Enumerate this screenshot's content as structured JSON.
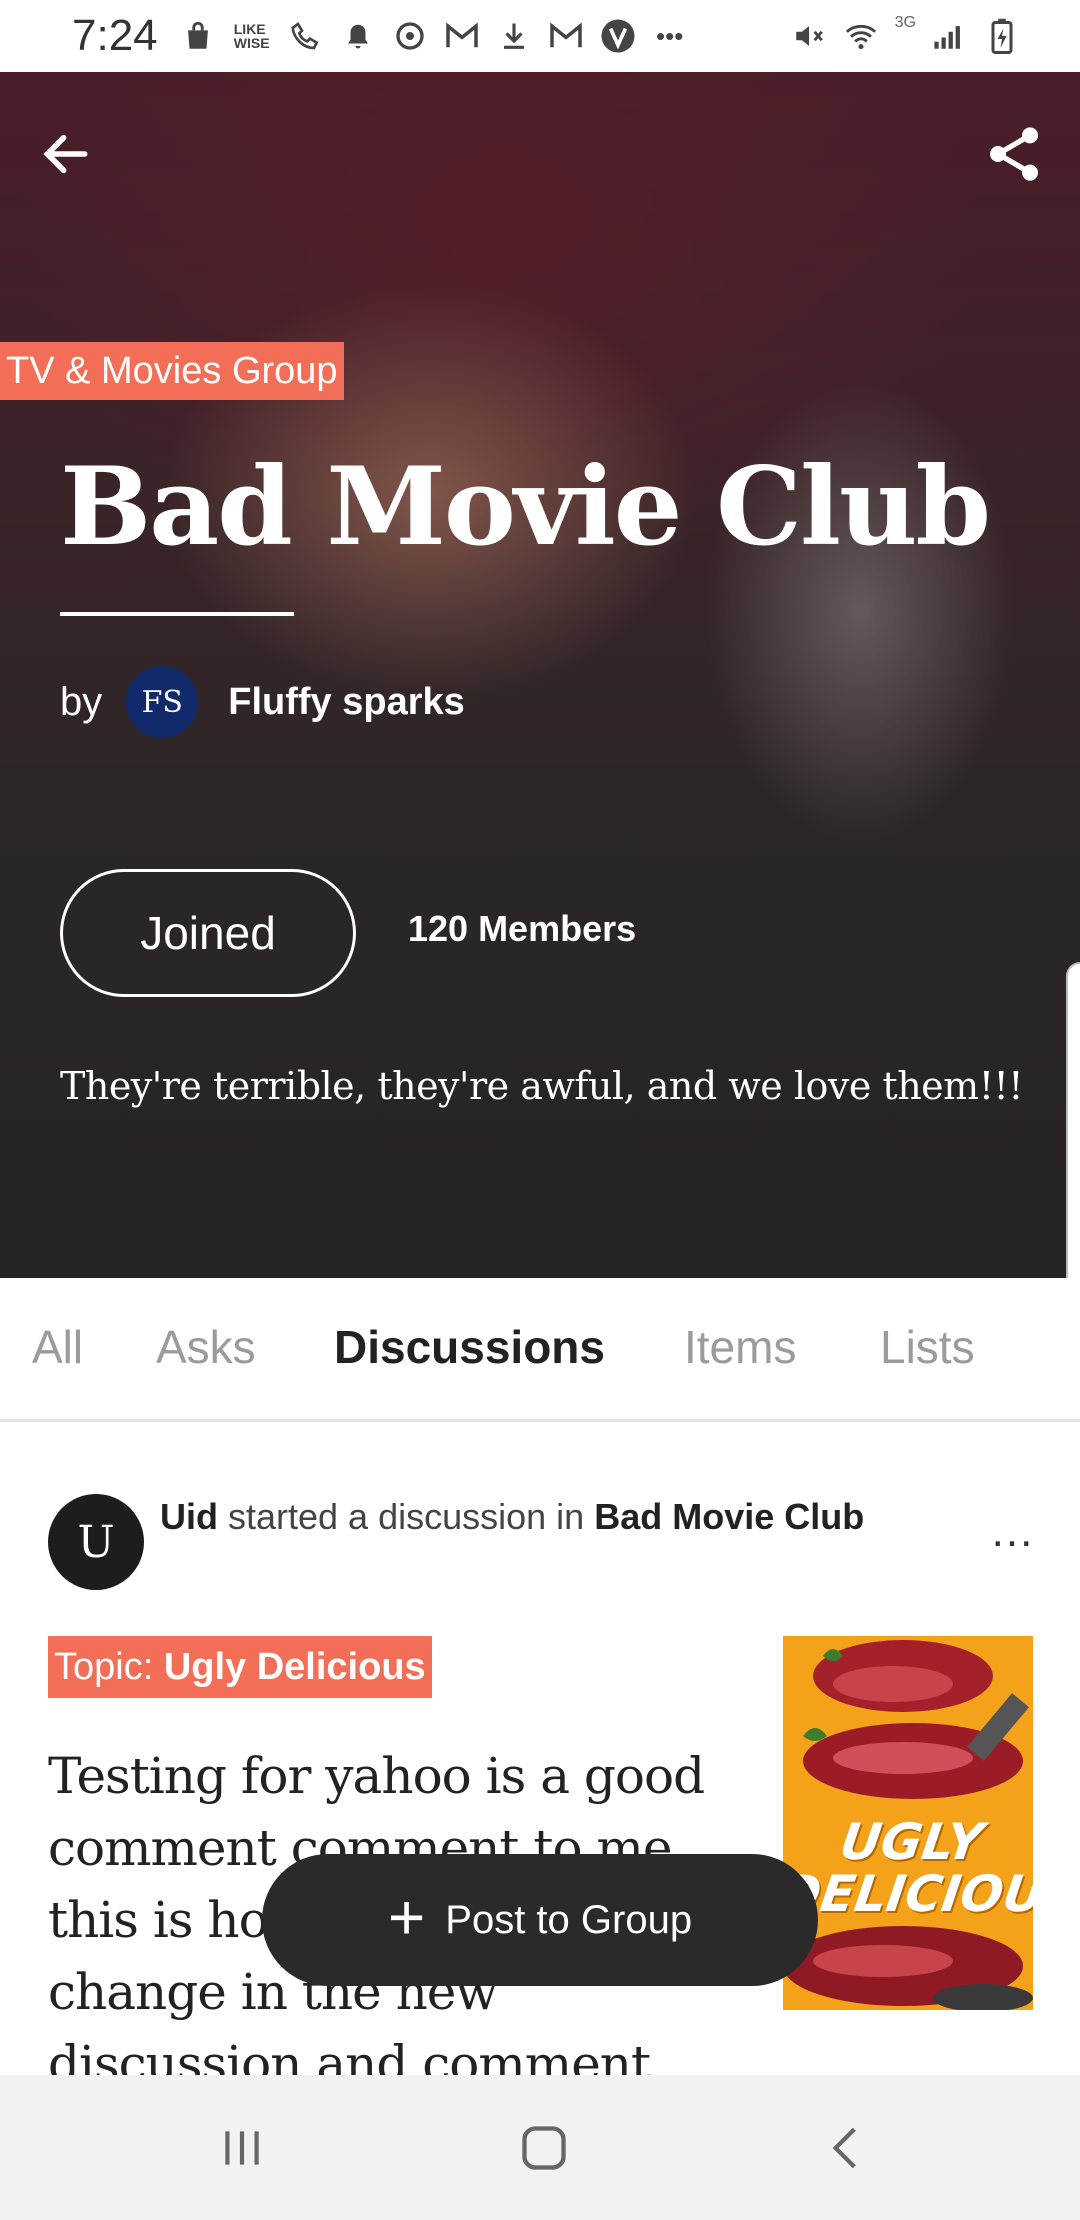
{
  "status_bar": {
    "time": "7:24",
    "network_label": "3G",
    "icons_left": [
      "shopping-bag-icon",
      "likewise-icon",
      "wifi-call-icon",
      "bell-icon",
      "sync-icon",
      "gmail-icon",
      "download-icon",
      "gmail-icon",
      "check-badge-icon",
      "more-icon"
    ],
    "icons_right": [
      "mute-icon",
      "wifi-icon",
      "signal-icon",
      "battery-icon"
    ]
  },
  "hero": {
    "group_label": "TV & Movies Group",
    "title": "Bad Movie Club",
    "by_label": "by",
    "owner_initials": "FS",
    "owner_name": "Fluffy sparks",
    "joined_label": "Joined",
    "members": "120 Members",
    "description": "They're terrible, they're awful, and we love them!!!"
  },
  "tabs": [
    {
      "label": "All",
      "active": false
    },
    {
      "label": "Asks",
      "active": false
    },
    {
      "label": "Discussions",
      "active": true
    },
    {
      "label": "Items",
      "active": false
    },
    {
      "label": "Lists",
      "active": false
    }
  ],
  "post": {
    "author_initial": "U",
    "author": "Uid",
    "action": " started a discussion in ",
    "group": "Bad Movie Club",
    "more": "...",
    "topic_prefix": "Topic: ",
    "topic": "Ugly Delicious",
    "body": "Testing for yahoo is a good comment comment to me this is how to make a change in the new discussion and comment comment here is",
    "thumbnail_text": "UGLY DELICIOUS"
  },
  "fab": {
    "label": "Post to Group"
  },
  "colors": {
    "accent": "#f26e56",
    "fab_bg": "#2a2a2a",
    "owner_avatar": "#102a6b"
  }
}
